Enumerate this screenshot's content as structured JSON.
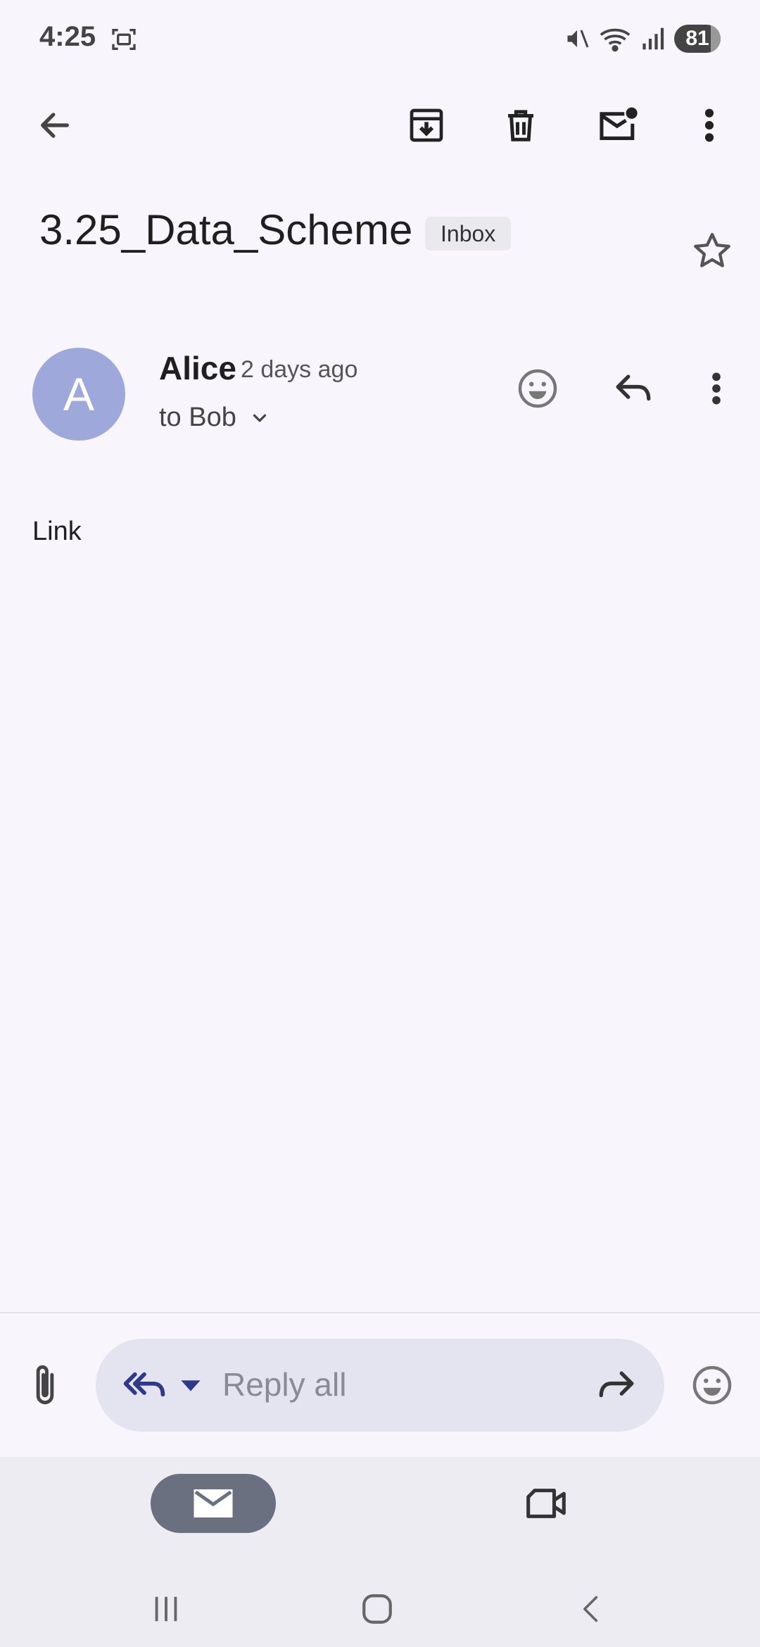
{
  "status_bar": {
    "time": "4:25",
    "battery_level": "81",
    "icons": [
      "screenshot-icon",
      "mute-icon",
      "wifi-icon",
      "signal-icon",
      "battery-icon"
    ]
  },
  "toolbar": {
    "icons": [
      "back-arrow-icon",
      "archive-icon",
      "delete-icon",
      "mark-unread-icon",
      "more-options-icon"
    ]
  },
  "email": {
    "subject": "3.25_Data_Scheme",
    "label": "Inbox",
    "starred": false,
    "sender": {
      "initial": "A",
      "name": "Alice",
      "time": "2 days ago",
      "recipients": "to Bob",
      "avatar_color": "#9fa8da"
    },
    "body": "Link"
  },
  "reply_bar": {
    "placeholder": "Reply all"
  },
  "bottom_nav": {
    "items": [
      "mail-icon",
      "meet-icon"
    ],
    "active": "mail-icon"
  },
  "colors": {
    "background": "#f8f6fc",
    "reply_pill": "#e4e4f0",
    "nav_active": "#6b7080",
    "reply_all_icon": "#2e3a87"
  }
}
